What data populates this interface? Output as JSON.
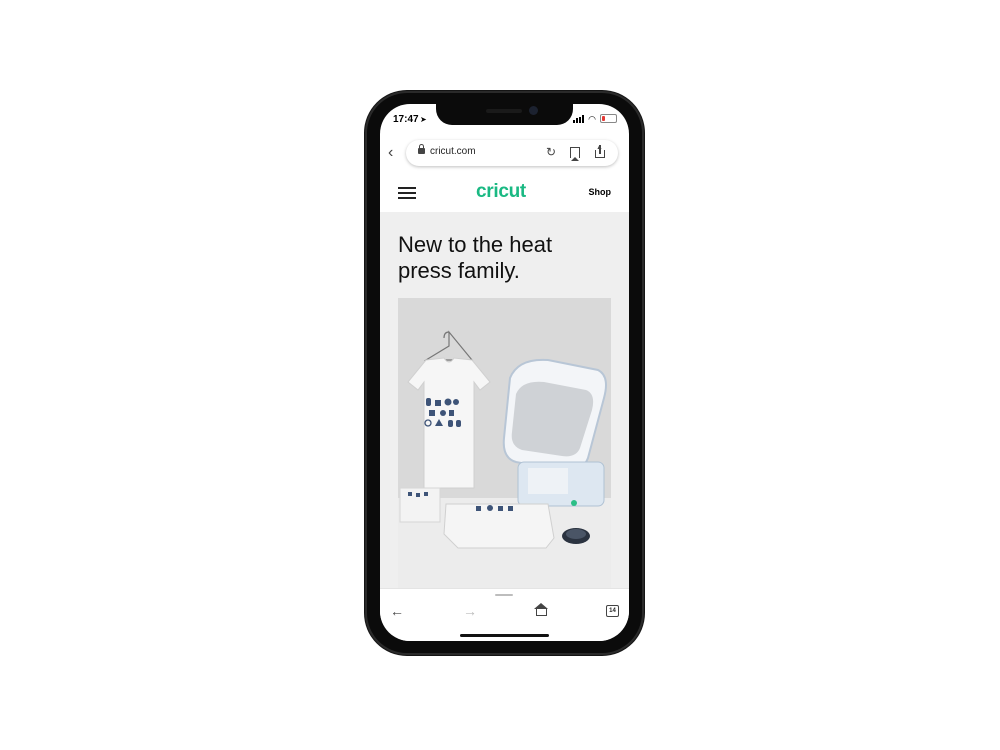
{
  "status_bar": {
    "time": "17:47",
    "location_icon": "location-arrow-icon"
  },
  "browser": {
    "url": "cricut.com",
    "icons": [
      "back-chevron-icon",
      "lock-icon",
      "reload-icon",
      "bookmark-icon",
      "share-icon"
    ]
  },
  "site_header": {
    "logo": "cricut",
    "shop_label": "Shop",
    "menu_icon": "hamburger-menu-icon"
  },
  "hero": {
    "headline": "New to the heat press family.",
    "image": "T-shirt and heat press product photo"
  },
  "bottom_toolbar": {
    "icons": [
      "back-arrow-icon",
      "forward-arrow-icon",
      "home-icon",
      "tabs-icon"
    ],
    "tabs_count": "14"
  },
  "colors": {
    "brand_green": "#1ab983",
    "hero_background": "#efefef"
  }
}
